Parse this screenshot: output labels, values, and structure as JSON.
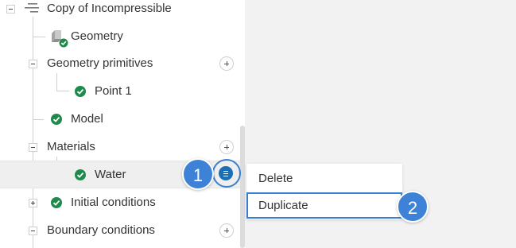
{
  "tree": {
    "root_label": "Copy of Incompressible",
    "geometry_label": "Geometry",
    "geometry_primitives_label": "Geometry primitives",
    "point_label": "Point 1",
    "model_label": "Model",
    "materials_label": "Materials",
    "water_label": "Water",
    "initial_conditions_label": "Initial conditions",
    "boundary_conditions_label": "Boundary conditions"
  },
  "context_menu": {
    "delete_label": "Delete",
    "duplicate_label": "Duplicate"
  },
  "steps": {
    "step1": "1",
    "step2": "2"
  },
  "colors": {
    "check_green": "#1f8a4c",
    "accent_blue": "#3d82d6",
    "menu_button_blue": "#1d6fb5"
  }
}
